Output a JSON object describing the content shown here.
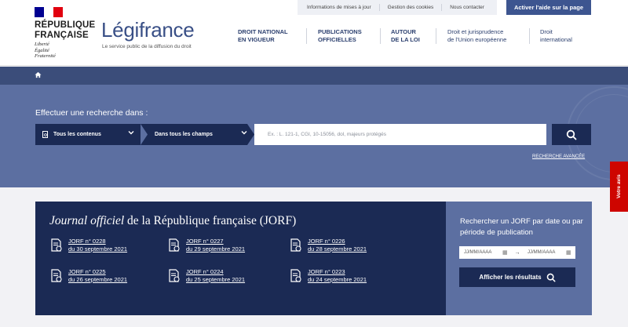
{
  "header": {
    "republic_name_line1": "RÉPUBLIQUE",
    "republic_name_line2": "FRANÇAISE",
    "motto": [
      "Liberté",
      "Égalité",
      "Fraternité"
    ],
    "site_title": "Légifrance",
    "site_subtitle": "Le service public de la diffusion du droit",
    "utility_links": [
      "Informations de mises à jour",
      "Gestion des cookies",
      "Nous contacter"
    ],
    "help_button": "Activer l'aide sur la page",
    "nav": [
      {
        "line1": "DROIT NATIONAL",
        "line2": "EN VIGUEUR"
      },
      {
        "line1": "PUBLICATIONS",
        "line2": "OFFICIELLES"
      },
      {
        "line1": "AUTOUR",
        "line2": "DE LA LOI"
      },
      {
        "line1": "Droit et jurisprudence",
        "line2": "de l'Union européenne"
      },
      {
        "line1": "Droit",
        "line2": "international"
      }
    ]
  },
  "breadcrumb": {
    "home_icon": "home-icon"
  },
  "search": {
    "label": "Effectuer une recherche dans :",
    "scope_select": "Tous les contenus",
    "field_select": "Dans tous les champs",
    "placeholder": "Ex. : L. 121-1, CGI, 10-15056, dol, majeurs protégés",
    "advanced_link": "RECHERCHE AVANCÉE",
    "search_icon": "search-icon"
  },
  "feedback_tab": "Votre avis",
  "jorf": {
    "title_italic": "Journal officiel",
    "title_rest": " de la République française (JORF)",
    "items": [
      {
        "number": "JORF n° 0228",
        "date": "du 30 septembre 2021"
      },
      {
        "number": "JORF n° 0227",
        "date": "du 29 septembre 2021"
      },
      {
        "number": "JORF n° 0226",
        "date": "du 28 septembre 2021"
      },
      {
        "number": "JORF n° 0225",
        "date": "du 26 septembre 2021"
      },
      {
        "number": "JORF n° 0224",
        "date": "du 25 septembre 2021"
      },
      {
        "number": "JORF n° 0223",
        "date": "du 24 septembre 2021"
      }
    ]
  },
  "date_search": {
    "title": "Rechercher un JORF par date ou par période de publication",
    "from_placeholder": "JJ/MM/AAAA",
    "to_placeholder": "JJ/MM/AAAA",
    "button": "Afficher les résultats"
  },
  "colors": {
    "brand_blue": "#000091",
    "brand_red": "#e1000f",
    "navy": "#1b2a54",
    "band": "#5c6fa1",
    "crumb": "#3b4d7a",
    "feedback_red": "#ce0500"
  }
}
